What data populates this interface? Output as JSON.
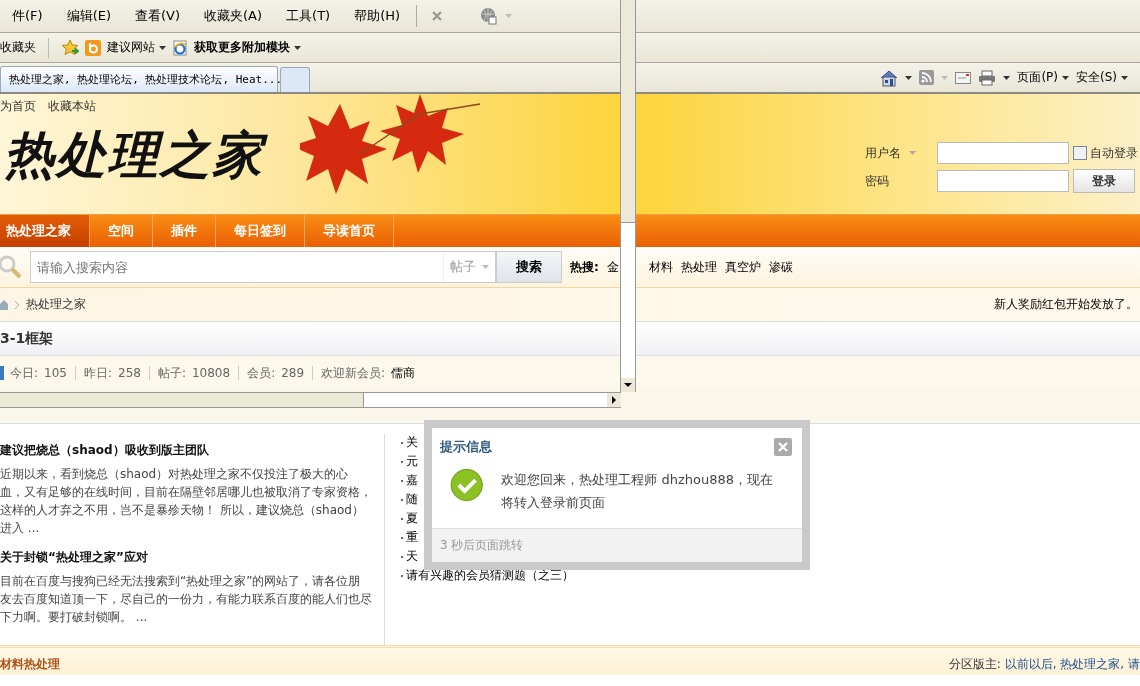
{
  "browser": {
    "menu": [
      "件(F)",
      "编辑(E)",
      "查看(V)",
      "收藏夹(A)",
      "工具(T)",
      "帮助(H)"
    ],
    "favorites_label": "收藏夹",
    "favorites": [
      {
        "label": "建议网站",
        "kind": "site"
      },
      {
        "label": "获取更多附加模块",
        "kind": "addon"
      }
    ],
    "tabs": [
      {
        "title": "热处理之家, 热处理论坛, 热处理技术论坛, Heat...",
        "selected": true
      }
    ],
    "command_menus": [
      "页面(P)",
      "安全(S)"
    ]
  },
  "site": {
    "top_links": [
      "为首页",
      "收藏本站"
    ],
    "logo": "热处理之家",
    "login": {
      "username_label": "用户名",
      "password_label": "密码",
      "remember_label": "自动登录",
      "remember_checked": false,
      "submit": "登录"
    },
    "nav": [
      {
        "label": "热处理之家",
        "selected": true
      },
      {
        "label": "空间",
        "selected": false
      },
      {
        "label": "插件",
        "selected": false
      },
      {
        "label": "每日签到",
        "selected": false
      },
      {
        "label": "导读首页",
        "selected": false
      }
    ],
    "search": {
      "placeholder": "请输入搜索内容",
      "scope": "帖子",
      "button": "搜索",
      "hot_label": "热搜:",
      "hot_terms": [
        "金",
        "材料",
        "热处理",
        "真空炉",
        "渗碳"
      ]
    },
    "breadcrumb": [
      "热处理之家"
    ],
    "notice": "新人奖励红包开始发放了。",
    "forum_title": "3-1框架",
    "stats": [
      {
        "label": "今日:",
        "value": "105"
      },
      {
        "label": "昨日:",
        "value": "258"
      },
      {
        "label": "帖子:",
        "value": "10808"
      },
      {
        "label": "会员:",
        "value": "289"
      },
      {
        "label": "欢迎新会员:",
        "value": "儒商"
      }
    ],
    "articles": [
      {
        "title": "建议把烧总（shaod）吸收到版主团队",
        "body": "近期以来，看到烧总（shaod）对热处理之家不仅投注了极大的心血，又有足够的在线时间，目前在隔壁邻居哪儿也被取消了专家资格，这样的人才弃之不用，岂不是暴殄天物！ 所以，建议烧总（shaod）进入 ..."
      },
      {
        "title": "关于封锁“热处理之家”应对",
        "body": "目前在百度与搜狗已经无法搜索到“热处理之家”的网站了，请各位朋友去百度知道顶一下，尽自己的一份力，有能力联系百度的能人们也尽下力啊。要打破封锁啊。 ..."
      }
    ],
    "side_list": [
      "关",
      "元",
      "嘉",
      "随",
      "夏",
      "重",
      "天",
      "请有兴趣的会员猜测题（之三）"
    ],
    "section": {
      "title": "材料热处理",
      "moderators_label": "分区版主:",
      "moderators": "以前以后, 热处理之家, 请"
    }
  },
  "dialog": {
    "title": "提示信息",
    "message": "欢迎您回来，热处理工程师 dhzhou888，现在将转入登录前页面",
    "footer": "3 秒后页面跳转"
  }
}
